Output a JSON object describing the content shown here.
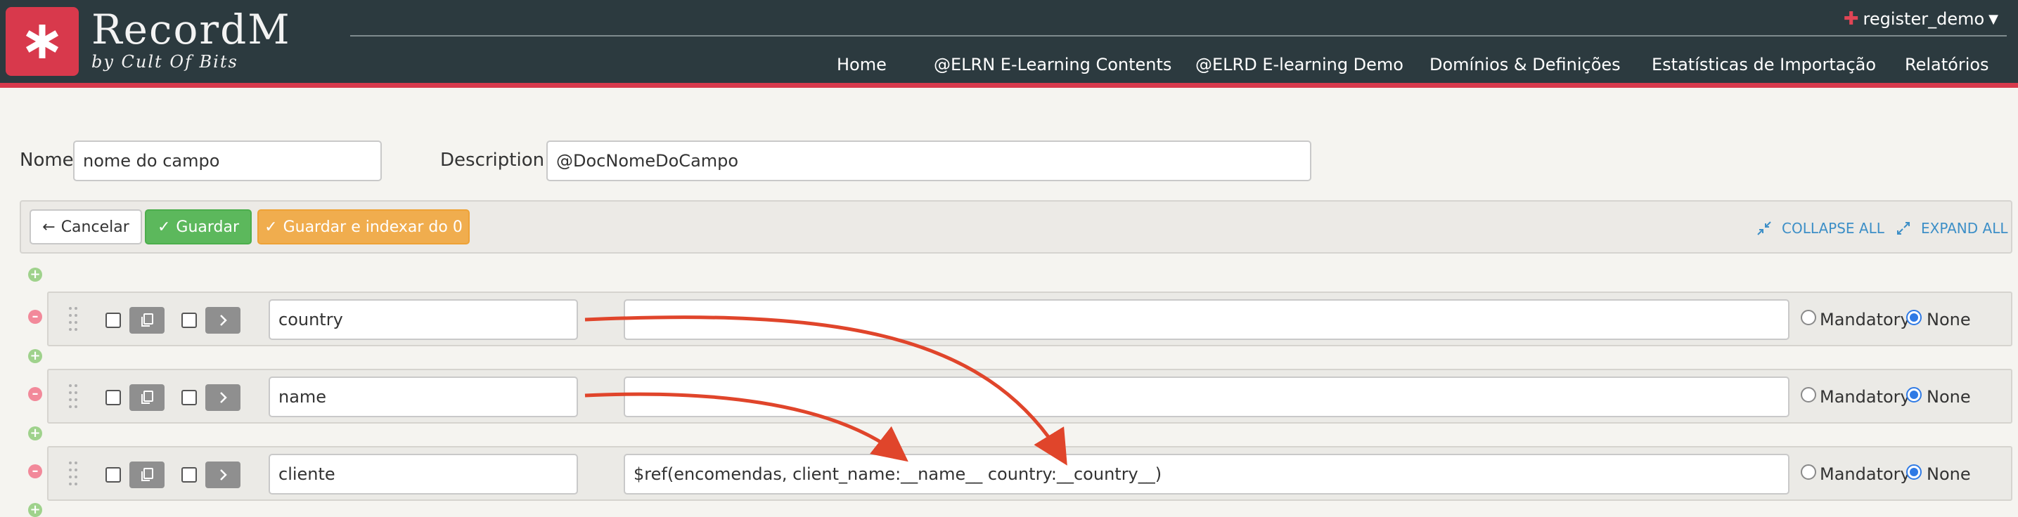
{
  "app": {
    "brand": "RecordM",
    "brand_sub": "by Cult Of Bits",
    "user": "register_demo"
  },
  "nav": {
    "items": [
      {
        "label": "Home"
      },
      {
        "label": "@ELRN E-Learning Contents"
      },
      {
        "label": "@ELRD E-learning Demo"
      },
      {
        "label": "Domínios & Definições"
      },
      {
        "label": "Estatísticas de Importação"
      },
      {
        "label": "Relatórios"
      }
    ]
  },
  "form": {
    "name_label": "Nome",
    "name_value": "nome do campo",
    "description_label": "Description:",
    "description_value": "@DocNomeDoCampo"
  },
  "toolbar": {
    "cancel": "Cancelar",
    "save": "Guardar",
    "save_index": "Guardar e indexar do 0",
    "collapse_all": "COLLAPSE ALL",
    "expand_all": "EXPAND ALL"
  },
  "fields": [
    {
      "name": "country",
      "description": "",
      "mandatory_label": "Mandatory",
      "none_label": "None",
      "selected": "None"
    },
    {
      "name": "name",
      "description": "",
      "mandatory_label": "Mandatory",
      "none_label": "None",
      "selected": "None"
    },
    {
      "name": "cliente",
      "description": "$ref(encomendas, client_name:__name__ country:__country__)",
      "mandatory_label": "Mandatory",
      "none_label": "None",
      "selected": "None"
    }
  ],
  "colors": {
    "header_bg": "#2c3a3f",
    "brand_red": "#d8394c",
    "save_green": "#5cb85c",
    "save_index_orange": "#f0ad4e",
    "link_blue": "#3d8fc7",
    "arrow_red": "#e0452b"
  },
  "icons": {
    "logo": "asterisk-icon",
    "user": "person-icon",
    "cancel": "arrow-left-icon",
    "save": "check-icon",
    "collapse": "collapse-icon",
    "expand": "expand-icon",
    "copy": "copy-icon",
    "expand_row": "chevron-right-icon",
    "drag": "drag-handle-icon"
  }
}
